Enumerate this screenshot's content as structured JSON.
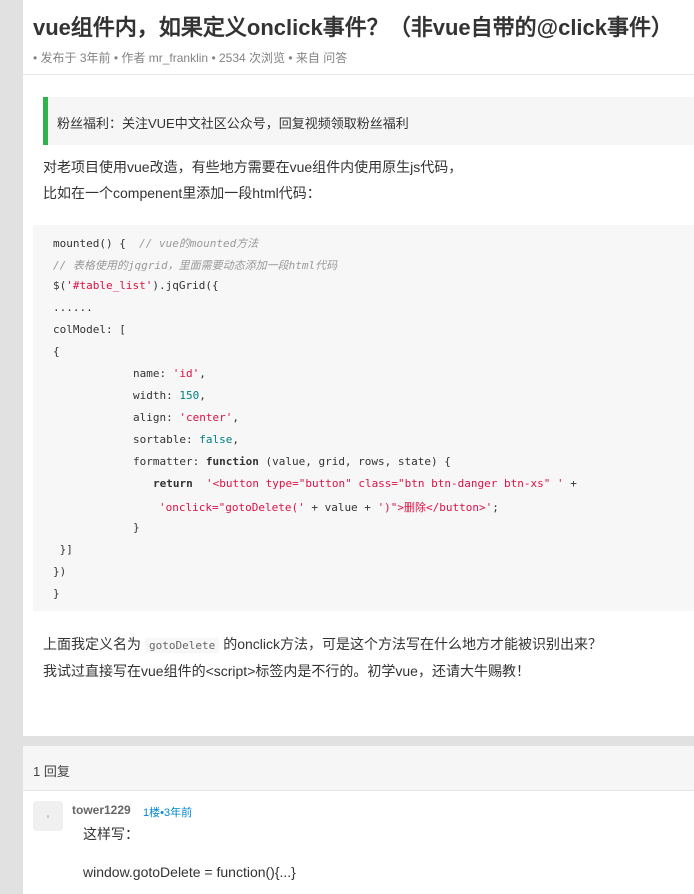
{
  "topic": {
    "title": "vue组件内，如果定义onclick事件？（非vue自带的@click事件）",
    "meta": {
      "posted": "• 发布于 3年前",
      "author": "• 作者 mr_franklin",
      "views": "• 2534 次浏览",
      "from": "• 来自 问答"
    },
    "notice": "粉丝福利：关注VUE中文社区公众号，回复视频领取粉丝福利",
    "intro_line1": "对老项目使用vue改造，有些地方需要在vue组件内使用原生js代码，",
    "intro_line2": "比如在一个compenent里添加一段html代码：",
    "code": {
      "l1_a": "mounted() {  ",
      "l1_comment": "// vue的mounted方法",
      "l2_comment": "// 表格使用的jqgrid，里面需要动态添加一段html代码",
      "l3_a": "$(",
      "l3_str": "'#table_list'",
      "l3_b": ").jqGrid({",
      "l4": "......",
      "l5": "colModel: [",
      "l6": "{",
      "l7_key": "name: ",
      "l7_val": "'id'",
      "l7_end": ",",
      "l8_key": "width: ",
      "l8_val": "150",
      "l8_end": ",",
      "l9_key": "align: ",
      "l9_val": "'center'",
      "l9_end": ",",
      "l10_key": "sortable: ",
      "l10_val": "false",
      "l10_end": ",",
      "l11_key": "formatter: ",
      "l11_kw": "function",
      "l11_rest": " (value, grid, rows, state) {",
      "l12_kw": "return",
      "l12_str": "'<button type=\"button\" class=\"btn btn-danger btn-xs\" '",
      "l12_end": " +",
      "l13_str1": "'onclick=\"gotoDelete('",
      "l13_mid": " + value + ",
      "l13_str2": "')\">删除</button>'",
      "l13_end": ";",
      "l14": "}",
      "l15": " }]",
      "l16": "})",
      "l17": "}"
    },
    "question_line1_a": "上面我定义名为",
    "question_code": "gotoDelete",
    "question_line1_b": "的onclick方法，可是这个方法写在什么地方才能被识别出来？",
    "question_line2": "我试过直接写在vue组件的<script>标签内是不行的。初学vue，还请大牛赐教！"
  },
  "replies": {
    "count_label": "1 回复",
    "items": [
      {
        "author": "tower1229",
        "floor": "1楼•3年前",
        "line1": "这样写：",
        "line2": "window.gotoDelete = function(){...}"
      }
    ]
  },
  "colors": {
    "accent_green": "#31b34b",
    "link_blue": "#0088cc",
    "string_red": "#dd1144",
    "number_teal": "#008080"
  }
}
